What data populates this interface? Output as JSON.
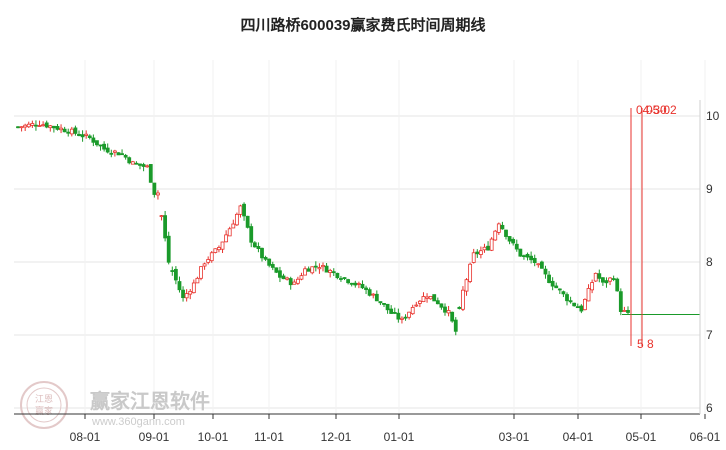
{
  "chart_data": {
    "type": "candlestick",
    "title": "四川路桥600039赢家费氏时间周期线",
    "ylim": [
      6,
      10.2
    ],
    "y_ticks": [
      "10",
      "9",
      "8",
      "7",
      "6"
    ],
    "x_ticks": [
      "08-01",
      "09-01",
      "10-01",
      "11-01",
      "12-01",
      "01-01",
      "03-01",
      "04-01",
      "05-01",
      "06-01"
    ],
    "grid": true,
    "colors": {
      "up": "#e8322c",
      "down": "#1a9a2a",
      "cycle_line": "#e8322c",
      "last_price_line": "#1a9a2a"
    },
    "close_path": [
      [
        0,
        9.85
      ],
      [
        6,
        9.9
      ],
      [
        14,
        9.8
      ],
      [
        20,
        9.7
      ],
      [
        24,
        9.55
      ],
      [
        29,
        9.48
      ],
      [
        32,
        9.35
      ],
      [
        36,
        9.3
      ],
      [
        38,
        8.95
      ],
      [
        39,
        8.95
      ],
      [
        42,
        8.0
      ],
      [
        46,
        7.5
      ],
      [
        49,
        7.7
      ],
      [
        52,
        8.0
      ],
      [
        56,
        8.2
      ],
      [
        60,
        8.55
      ],
      [
        62,
        8.75
      ],
      [
        65,
        8.3
      ],
      [
        69,
        8.0
      ],
      [
        73,
        7.8
      ],
      [
        77,
        7.7
      ],
      [
        80,
        7.9
      ],
      [
        84,
        7.95
      ],
      [
        88,
        7.85
      ],
      [
        92,
        7.75
      ],
      [
        96,
        7.65
      ],
      [
        100,
        7.5
      ],
      [
        104,
        7.3
      ],
      [
        107,
        7.2
      ],
      [
        111,
        7.45
      ],
      [
        114,
        7.55
      ],
      [
        117,
        7.45
      ],
      [
        120,
        7.3
      ],
      [
        122,
        7.05
      ],
      [
        124,
        7.6
      ],
      [
        127,
        8.1
      ],
      [
        131,
        8.2
      ],
      [
        134,
        8.55
      ],
      [
        137,
        8.3
      ],
      [
        140,
        8.1
      ],
      [
        144,
        8.0
      ],
      [
        148,
        7.75
      ],
      [
        151,
        7.6
      ],
      [
        154,
        7.45
      ],
      [
        157,
        7.35
      ],
      [
        159,
        7.6
      ],
      [
        161,
        7.85
      ],
      [
        163,
        7.7
      ],
      [
        166,
        7.8
      ],
      [
        168,
        7.35
      ],
      [
        170,
        7.28
      ]
    ],
    "gaps_after": [
      39,
      42,
      122
    ],
    "last_price": 7.28,
    "cycle_lines": [
      {
        "label": "04-30",
        "date": "04-30"
      },
      {
        "label": "05-02",
        "date": "05-02"
      }
    ],
    "cycle_bottom_labels": [
      "5",
      "8"
    ]
  },
  "watermark": {
    "brand": "赢家江恩软件",
    "url": "www.360gann.com",
    "logo_text_top": "江恩",
    "logo_text_bottom": "赢家"
  }
}
